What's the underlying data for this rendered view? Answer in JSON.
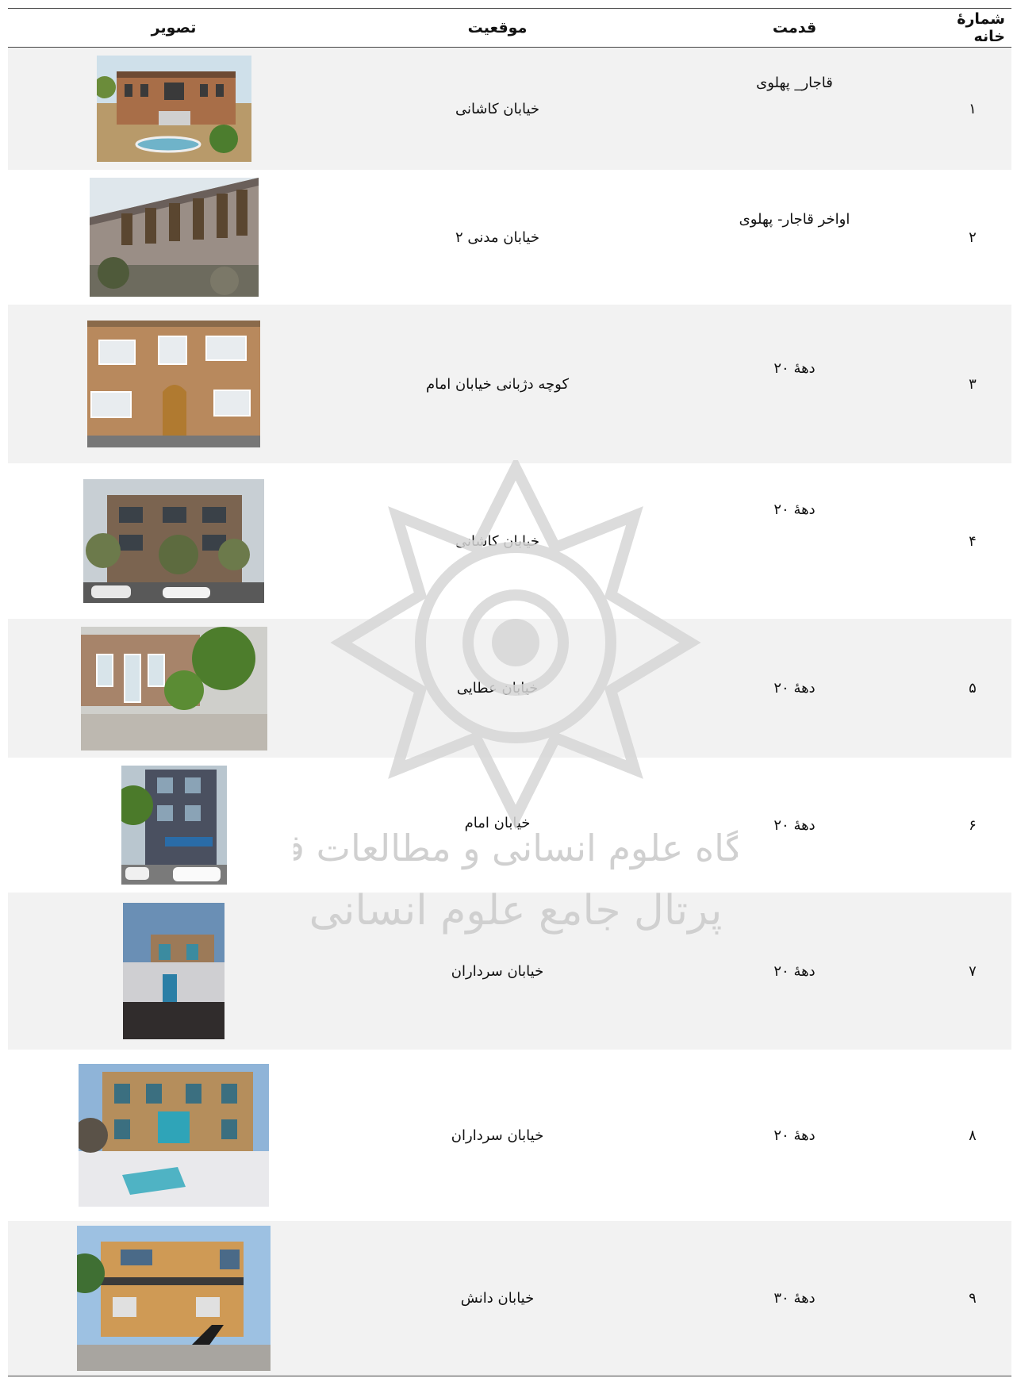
{
  "headers": {
    "number": "شمارهٔ خانه",
    "age": "قدمت",
    "location": "موقعیت",
    "image": "تصویر"
  },
  "rows": [
    {
      "number": "۱",
      "age": "قاجار_ پهلوی",
      "location": "خیابان کاشانی"
    },
    {
      "number": "۲",
      "age": "اواخر قاجار- پهلوی",
      "location": "خیابان مدنی ۲"
    },
    {
      "number": "۳",
      "age": "دهۀ ۲۰",
      "location": "کوچه دژبانی خیابان امام"
    },
    {
      "number": "۴",
      "age": "دهۀ ۲۰",
      "location": "خیابان کاشانی"
    },
    {
      "number": "۵",
      "age": "دهۀ ۲۰",
      "location": "خیابان عطایی"
    },
    {
      "number": "۶",
      "age": "دهۀ ۲۰",
      "location": "خیابان امام"
    },
    {
      "number": "۷",
      "age": "دهۀ ۲۰",
      "location": "خیابان سرداران"
    },
    {
      "number": "۸",
      "age": "دهۀ ۲۰",
      "location": "خیابان سرداران"
    },
    {
      "number": "۹",
      "age": "دهۀ ۳۰",
      "location": "خیابان دانش"
    }
  ],
  "watermark": {
    "line1": "پژوهشگاه علوم انسانی و مطالعات فرهنگی",
    "line2": "پرتال جامع علوم انسانی"
  }
}
